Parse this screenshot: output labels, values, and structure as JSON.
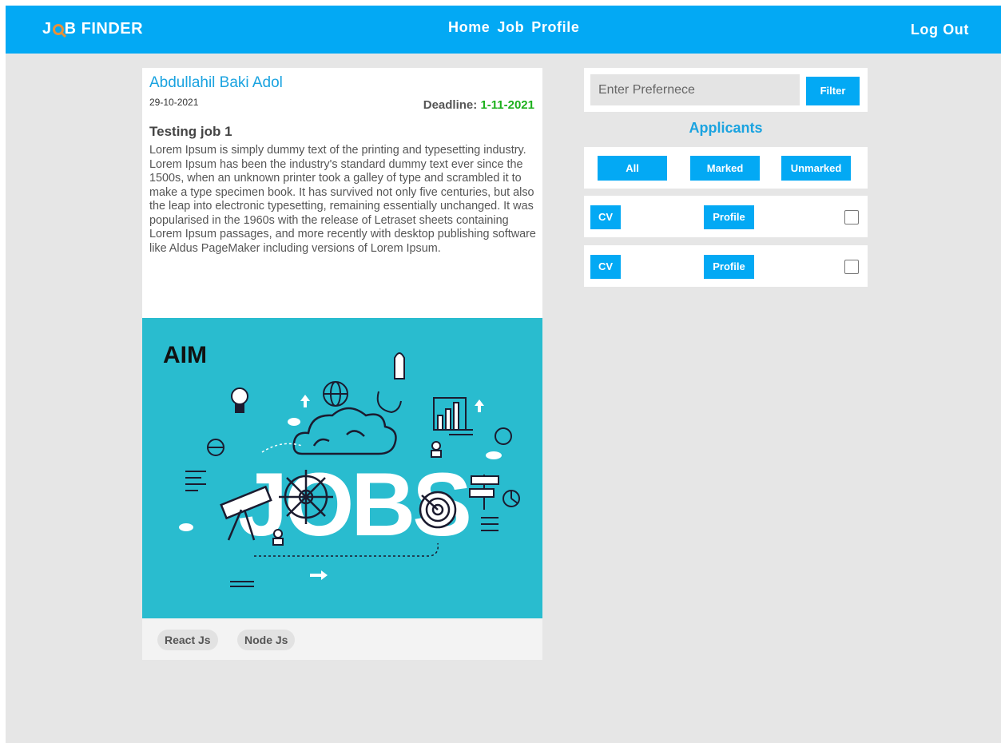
{
  "navbar": {
    "logo_prefix": "J",
    "logo_suffix": "B FINDER",
    "links": [
      "Home",
      "Job",
      "Profile"
    ],
    "logout": "Log Out"
  },
  "job": {
    "poster": "Abdullahil Baki Adol",
    "posted_date": "29-10-2021",
    "deadline_label": "Deadline:",
    "deadline_value": "1-11-2021",
    "title": "Testing job 1",
    "description": "Lorem Ipsum is simply dummy text of the printing and typesetting industry. Lorem Ipsum has been the industry's standard dummy text ever since the 1500s, when an unknown printer took a galley of type and scrambled it to make a type specimen book. It has survived not only five centuries, but also the leap into electronic typesetting, remaining essentially unchanged. It was popularised in the 1960s with the release of Letraset sheets containing Lorem Ipsum passages, and more recently with desktop publishing software like Aldus PageMaker including versions of Lorem Ipsum.",
    "image": {
      "brand": "AIM",
      "headline": "JOBS"
    },
    "tags": [
      "React Js",
      "Node Js"
    ]
  },
  "filter": {
    "placeholder": "Enter Prefernece",
    "button": "Filter"
  },
  "applicants": {
    "heading": "Applicants",
    "tabs": [
      "All",
      "Marked",
      "Unmarked"
    ],
    "rows": [
      {
        "cv_label": "CV",
        "profile_label": "Profile"
      },
      {
        "cv_label": "CV",
        "profile_label": "Profile"
      }
    ]
  },
  "colors": {
    "primary": "#03a9f4",
    "background": "#e6e6e6",
    "deadline": "#1cb01c",
    "image_bg": "#29bccf",
    "logo_accent": "#e8903a"
  }
}
